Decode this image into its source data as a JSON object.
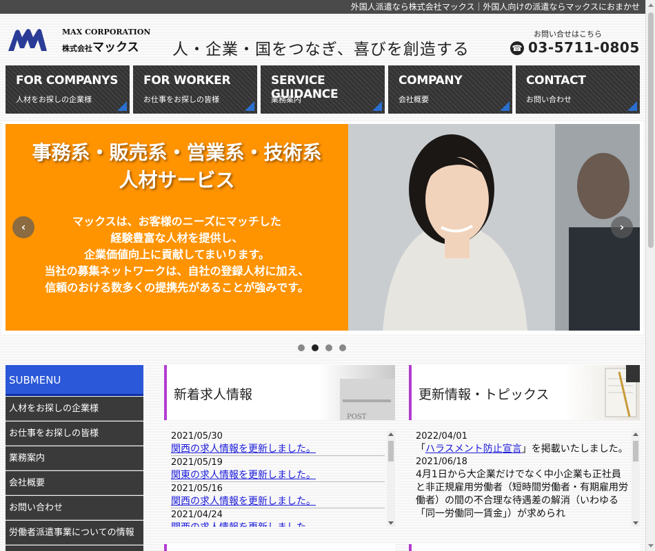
{
  "topbar": {
    "text": "外国人派遣なら株式会社マックス｜外国人向けの派遣ならマックスにおまかせ"
  },
  "header": {
    "logo_en": "MAX CORPORATION",
    "logo_jp_prefix": "株式会社",
    "logo_jp_name": "マックス",
    "tagline": "人・企業・国をつなぎ、喜びを創造する",
    "contact_label": "お問い合せはこちら",
    "phone": "03-5711-0805"
  },
  "nav": {
    "items": [
      {
        "en": "FOR COMPANYS",
        "jp": "人材をお探しの企業様"
      },
      {
        "en": "FOR WORKER",
        "jp": "お仕事をお探しの皆様"
      },
      {
        "en": "SERVICE GUIDANCE",
        "jp": "業務案内"
      },
      {
        "en": "COMPANY",
        "jp": "会社概要"
      },
      {
        "en": "CONTACT",
        "jp": "お問い合わせ"
      }
    ]
  },
  "slider": {
    "title_line1": "事務系・販売系・営業系・技術系",
    "title_line2": "人材サービス",
    "body": [
      "マックスは、お客様のニーズにマッチした",
      "経験豊富な人材を提供し、",
      "企業価値向上に貢献してまいります。",
      "当社の募集ネットワークは、自社の登録人材に加え、",
      "信頼のおける数多くの提携先があることが強みです。"
    ],
    "prev": "‹",
    "next": "›",
    "active_dot": 2,
    "dot_count": 4
  },
  "submenu": {
    "title": "SUBMENU",
    "items": [
      "人材をお探しの企業様",
      "お仕事をお探しの皆様",
      "業務案内",
      "会社概要",
      "お問い合わせ",
      "労働者派遣事業についての情報"
    ]
  },
  "jobs": {
    "title": "新着求人情報",
    "entries": [
      {
        "date": "2021/05/30",
        "text": "関西の求人情報を更新しました。"
      },
      {
        "date": "2021/05/19",
        "text": "関東の求人情報を更新しました。"
      },
      {
        "date": "2021/05/16",
        "text": "関西の求人情報を更新しました。"
      },
      {
        "date": "2021/04/24",
        "text": "関西の求人情報を更新しました。"
      }
    ]
  },
  "topics": {
    "title": "更新情報・トピックス",
    "entry1_date": "2022/04/01",
    "entry1_pre": "「",
    "entry1_link": "ハラスメント防止宣言",
    "entry1_post": "」を掲載いたしました。",
    "entry2_date": "2021/06/18",
    "entry2_text": "4月1日から大企業だけでなく中小企業も正社員と非正規雇用労働者（短時間労働者・有期雇用労働者）の間の不合理な待遇差の解消（いわゆる「同一労働同一賃金」）が求められ"
  },
  "colors": {
    "accent_blue": "#2b58d8",
    "slide_orange": "#ff9300",
    "panel_accent": "#b13ccf",
    "link": "#1a1adb"
  }
}
